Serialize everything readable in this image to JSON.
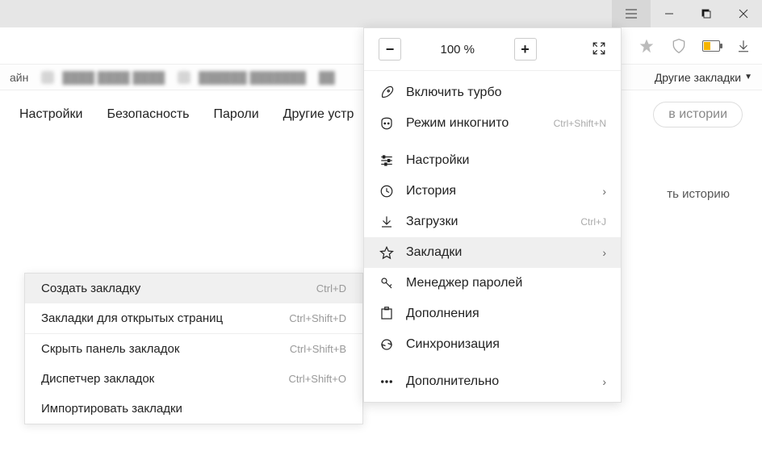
{
  "titlebar": {},
  "bookmarksbar": {
    "left_hint": "айн",
    "other": "Другие закладки"
  },
  "tabs": {
    "settings": "Настройки",
    "security": "Безопасность",
    "passwords": "Пароли",
    "other_devices": "Другие устр",
    "search_placeholder": "в истории"
  },
  "content": {
    "clear_history": "ть историю"
  },
  "menu": {
    "zoom": {
      "value": "100 %"
    },
    "turbo": "Включить турбо",
    "incognito": "Режим инкогнито",
    "incognito_short": "Ctrl+Shift+N",
    "settings": "Настройки",
    "history": "История",
    "downloads": "Загрузки",
    "downloads_short": "Ctrl+J",
    "bookmarks": "Закладки",
    "password_manager": "Менеджер паролей",
    "addons": "Дополнения",
    "sync": "Синхронизация",
    "more": "Дополнительно"
  },
  "submenu": {
    "create": "Создать закладку",
    "create_short": "Ctrl+D",
    "open_tabs": "Закладки для открытых страниц",
    "open_tabs_short": "Ctrl+Shift+D",
    "hide_bar": "Скрыть панель закладок",
    "hide_bar_short": "Ctrl+Shift+B",
    "manager": "Диспетчер закладок",
    "manager_short": "Ctrl+Shift+O",
    "import": "Импортировать закладки"
  }
}
